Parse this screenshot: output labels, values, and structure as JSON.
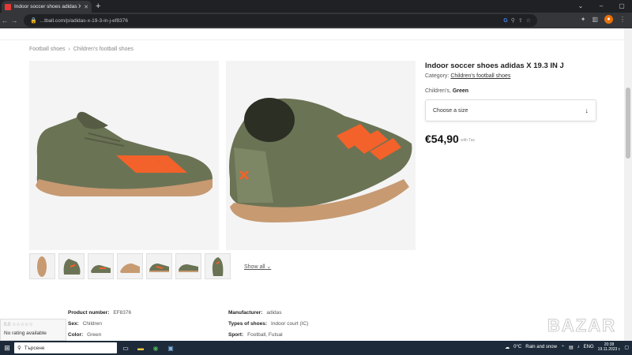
{
  "browser": {
    "tab_title": "Indoor soccer shoes adidas X 19",
    "url": "...tball.com/p/adidas-x-19-3-in-j-ef8376"
  },
  "breadcrumb": [
    "Football shoes",
    "Children's football shoes"
  ],
  "product": {
    "title": "Indoor soccer shoes adidas X 19.3 IN J",
    "category_label": "Category:",
    "category_link": "Children's football shoes",
    "variant_label": "Children's,",
    "variant_value": "Green",
    "size_placeholder": "Choose a size",
    "price": "€54,90",
    "tax_note": "with Tax"
  },
  "gallery": {
    "show_all": "Show all",
    "thumb_count": 7,
    "colors": {
      "shoe": "#6b7355",
      "stripe": "#f2622a",
      "sole": "#c79a72"
    }
  },
  "specs": {
    "product_number_label": "Product number:",
    "product_number": "EF8376",
    "sex_label": "Sex:",
    "sex": "Children",
    "color_label": "Color:",
    "color": "Green",
    "manufacturer_label": "Manufacturer:",
    "manufacturer": "adidas",
    "types_label": "Types of shoes:",
    "types": "Indoor court (IC)",
    "sport_label": "Sport:",
    "sport": "Football, Futsal"
  },
  "rating": {
    "score": "0.0",
    "text": "No rating available"
  },
  "watermark": "BAZAR",
  "taskbar": {
    "search_placeholder": "Търсене",
    "weather_temp": "0°C",
    "weather_text": "Rain and snow",
    "lang": "ENG",
    "time": "20:38",
    "date": "19.11.2023 г."
  }
}
